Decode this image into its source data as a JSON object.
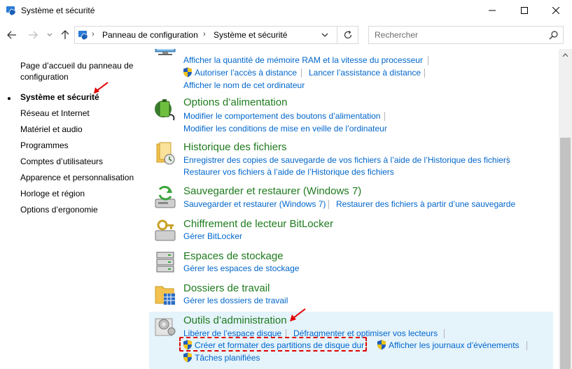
{
  "window": {
    "title": "Système et sécurité"
  },
  "address": {
    "crumbs": [
      "Panneau de configuration",
      "Système et sécurité"
    ]
  },
  "search": {
    "placeholder": "Rechercher"
  },
  "sidebar": {
    "home_label": "Page d’accueil du panneau de configuration",
    "items": [
      {
        "label": "Système et sécurité",
        "active": true
      },
      {
        "label": "Réseau et Internet"
      },
      {
        "label": "Matériel et audio"
      },
      {
        "label": "Programmes"
      },
      {
        "label": "Comptes d’utilisateurs"
      },
      {
        "label": "Apparence et personnalisation"
      },
      {
        "label": "Horloge et région"
      },
      {
        "label": "Options d’ergonomie"
      }
    ]
  },
  "categories": {
    "system": {
      "links": [
        "Afficher la quantité de mémoire RAM et la vitesse du processeur",
        "Autoriser l’accès à distance",
        "Lancer l’assistance à distance",
        "Afficher le nom de cet ordinateur"
      ]
    },
    "power": {
      "title": "Options d’alimentation",
      "links": [
        "Modifier le comportement des boutons d’alimentation",
        "Modifier les conditions de mise en veille de l’ordinateur"
      ]
    },
    "history": {
      "title": "Historique des fichiers",
      "links": [
        "Enregistrer des copies de sauvegarde de vos fichiers à l’aide de l’Historique des fichiers",
        "Restaurer vos fichiers à l’aide de l’Historique des fichiers"
      ]
    },
    "backup": {
      "title": "Sauvegarder et restaurer (Windows 7)",
      "links": [
        "Sauvegarder et restaurer (Windows 7)",
        "Restaurer des fichiers à partir d’une sauvegarde"
      ]
    },
    "bitlocker": {
      "title": "Chiffrement de lecteur BitLocker",
      "links": [
        "Gérer BitLocker"
      ]
    },
    "storage": {
      "title": "Espaces de stockage",
      "links": [
        "Gérer les espaces de stockage"
      ]
    },
    "workfolders": {
      "title": "Dossiers de travail",
      "links": [
        "Gérer les dossiers de travail"
      ]
    },
    "admin": {
      "title": "Outils d’administration",
      "links": [
        "Libérer de l’espace disque",
        "Défragmenter et optimiser vos lecteurs",
        "Créer et formater des partitions de disque dur",
        "Afficher les journaux d’événements",
        "Tâches planifiées"
      ]
    }
  },
  "colors": {
    "title_green": "#1e7b1e",
    "link_blue": "#0066cc",
    "highlight": "#e5f3fb",
    "annotation_red": "#e00000"
  }
}
